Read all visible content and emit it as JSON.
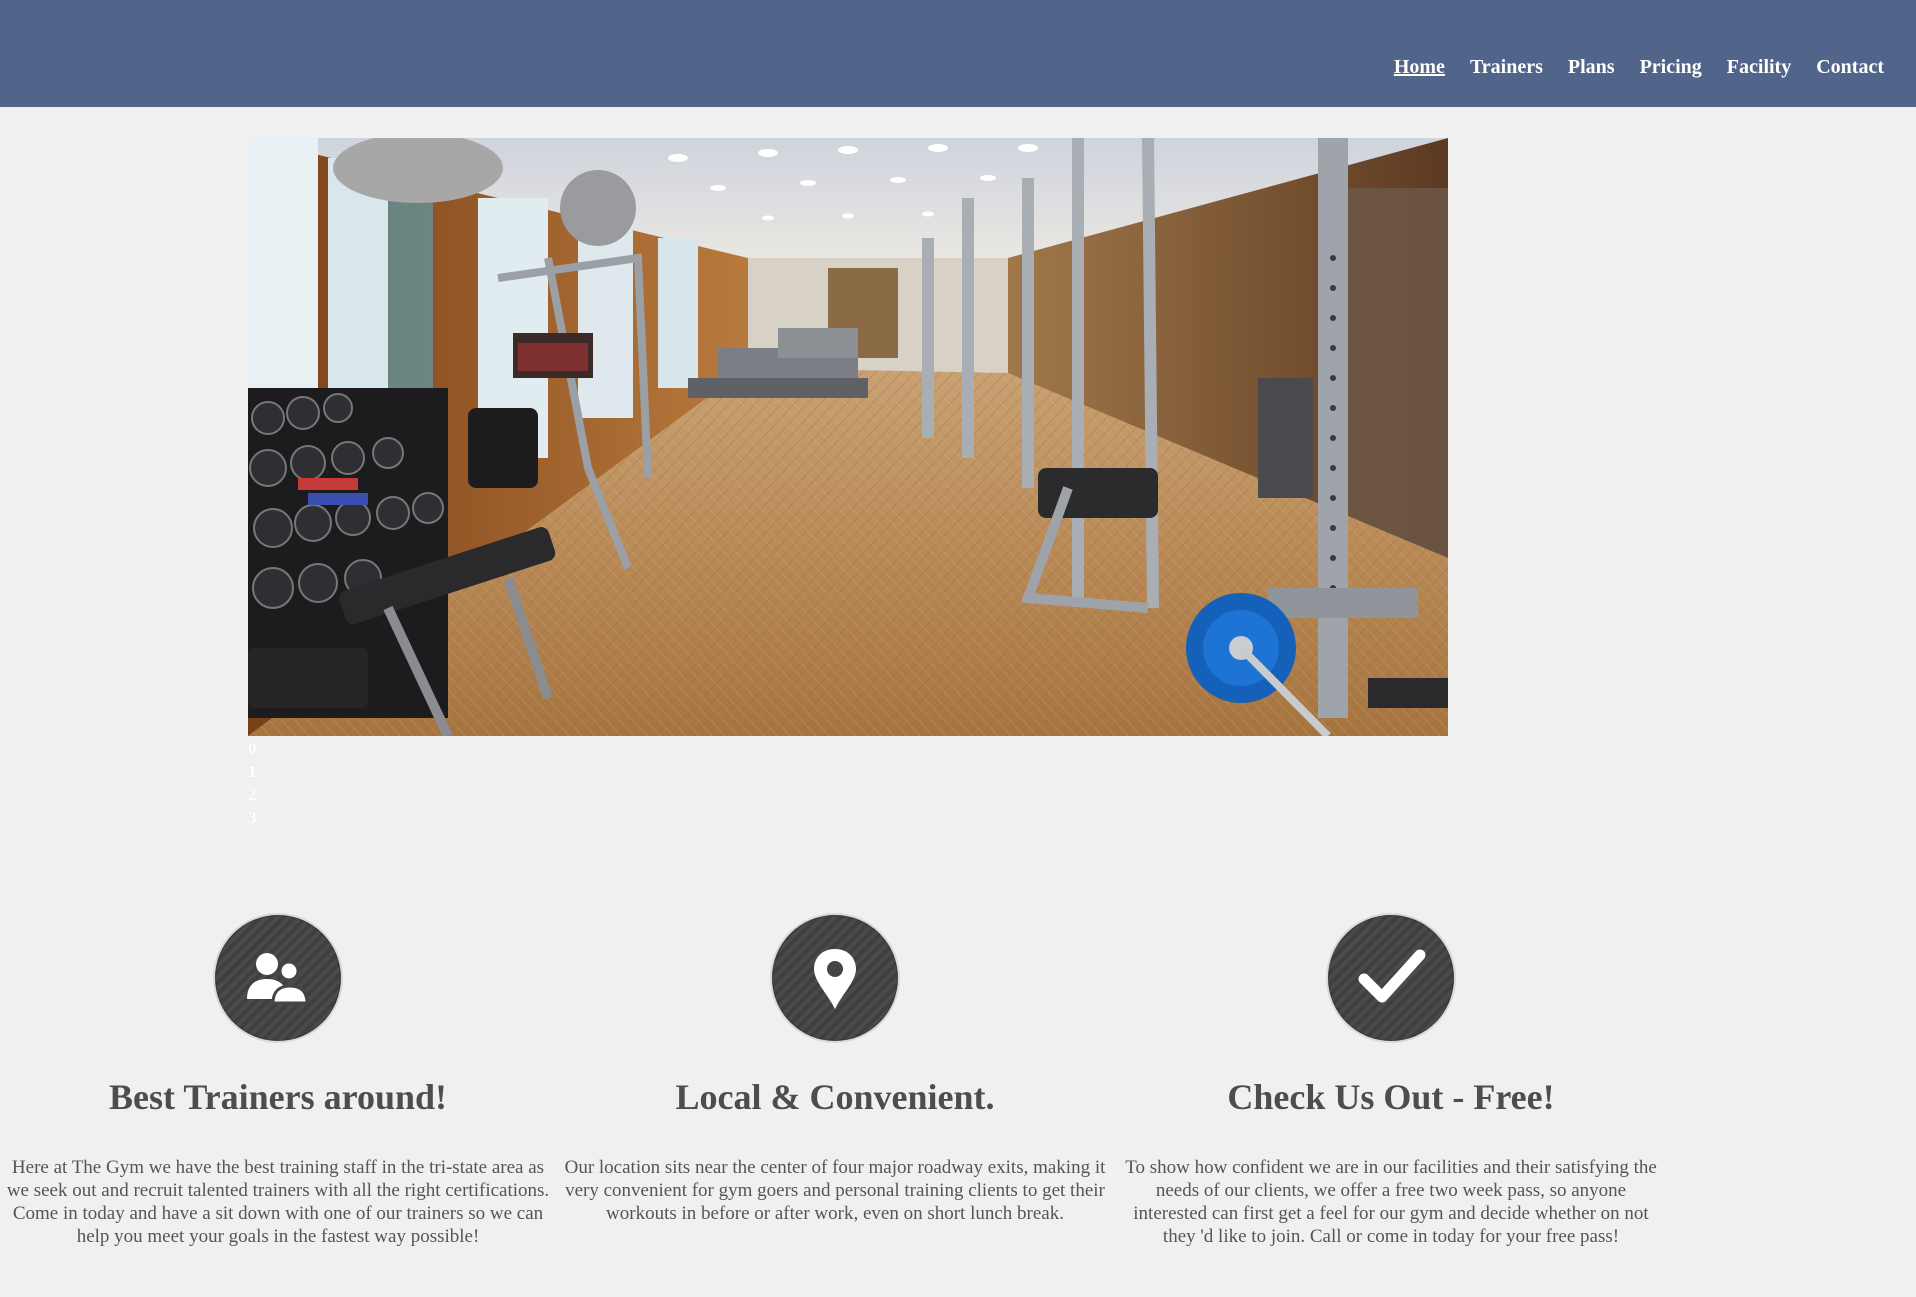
{
  "header": {
    "nav": [
      {
        "label": "Home",
        "active": true
      },
      {
        "label": "Trainers"
      },
      {
        "label": "Plans"
      },
      {
        "label": "Pricing"
      },
      {
        "label": "Facility"
      },
      {
        "label": "Contact"
      }
    ]
  },
  "hero": {
    "image_icon": "gym-interior-photo",
    "slide_indicators": [
      "0",
      "1",
      "2",
      "3"
    ]
  },
  "features": [
    {
      "icon": "users-icon",
      "title": "Best Trainers around!",
      "text": "Here at The Gym we have the best training staff in the tri-state area as we seek out and recruit talented trainers with all the right certifications. Come in today and have a sit down with one of our trainers so we can help you meet your goals in the fastest way possible!"
    },
    {
      "icon": "map-pin-icon",
      "title": "Local & Convenient.",
      "text": "Our location sits near the center of four major roadway exits, making it very convenient for gym goers and personal training clients to get their workouts in before or after work, even on short lunch break."
    },
    {
      "icon": "checkmark-icon",
      "title": "Check Us Out - Free!",
      "text": "To show how confident we are in our facilities and their satisfying the needs of our clients, we offer a free two week pass, so anyone interested can first get a feel for our gym and decide whether on not they 'd like to join. Call or come in today for your free pass!"
    }
  ],
  "colors": {
    "header_bg": "#51658b",
    "page_bg": "#f0f0f0",
    "badge_bg": "#444444"
  }
}
